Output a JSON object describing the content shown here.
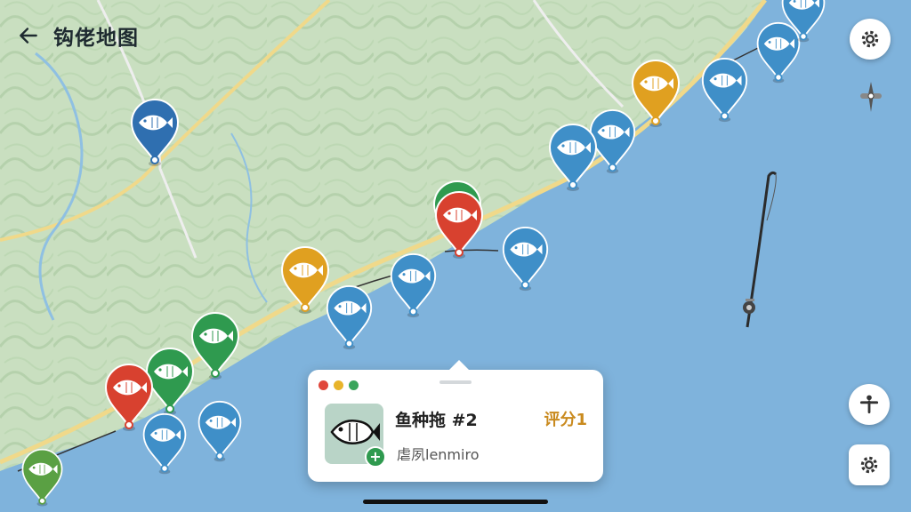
{
  "header": {
    "title": "钩佬地图",
    "back_icon": "arrow-left-icon"
  },
  "controls": {
    "settings_top_icon": "gear-icon",
    "compass_icon": "compass-icon",
    "person_icon": "person-icon",
    "settings_bottom_icon": "gear-icon"
  },
  "card": {
    "name": "鱼种拖 #2",
    "rating": "评分1",
    "subtitle": "虐夙lenmiro",
    "window_dot_colors": [
      "#e0473c",
      "#e8b42a",
      "#3aa55b"
    ],
    "thumb_icon": "fish-icon",
    "add_icon": "plus-icon",
    "add_label": "+"
  },
  "map": {
    "land_color": "#c9dfc0",
    "water_color": "#7fb3dc",
    "road_color": "#f0d98a",
    "markers": [
      {
        "id": "m1",
        "color": "#2f6fb0",
        "icon": "fish-icon"
      },
      {
        "id": "m2",
        "color": "#e0a020",
        "icon": "fish-icon"
      },
      {
        "id": "m3",
        "color": "#3f8fc8",
        "icon": "fish-icon"
      },
      {
        "id": "m4",
        "color": "#3f8fc8",
        "icon": "fish-icon"
      },
      {
        "id": "m5",
        "color": "#3f8fc8",
        "icon": "fish-icon"
      },
      {
        "id": "m6",
        "color": "#3f8fc8",
        "icon": "fish-icon"
      },
      {
        "id": "m7",
        "color": "#3f8fc8",
        "icon": "fish-icon"
      },
      {
        "id": "m8",
        "color": "#3f8fc8",
        "icon": "fish-icon"
      },
      {
        "id": "m9",
        "color": "#2f9a4f",
        "icon": "fish-icon"
      },
      {
        "id": "m10",
        "color": "#d8412f",
        "icon": "fish-icon"
      },
      {
        "id": "m11",
        "color": "#3f8fc8",
        "icon": "fish-icon"
      },
      {
        "id": "m12",
        "color": "#3f8fc8",
        "icon": "fish-icon"
      },
      {
        "id": "m13",
        "color": "#e0a020",
        "icon": "fish-icon"
      },
      {
        "id": "m14",
        "color": "#3f8fc8",
        "icon": "fish-icon"
      },
      {
        "id": "m15",
        "color": "#2f9a4f",
        "icon": "fish-icon"
      },
      {
        "id": "m16",
        "color": "#2f9a4f",
        "icon": "fish-icon"
      },
      {
        "id": "m17",
        "color": "#d8412f",
        "icon": "fish-icon"
      },
      {
        "id": "m18",
        "color": "#3f8fc8",
        "icon": "fish-icon"
      },
      {
        "id": "m19",
        "color": "#3f8fc8",
        "icon": "fish-icon"
      },
      {
        "id": "m20",
        "color": "#5aa043",
        "icon": "fish-icon"
      }
    ],
    "rod_icon": "fishing-rod-icon"
  }
}
